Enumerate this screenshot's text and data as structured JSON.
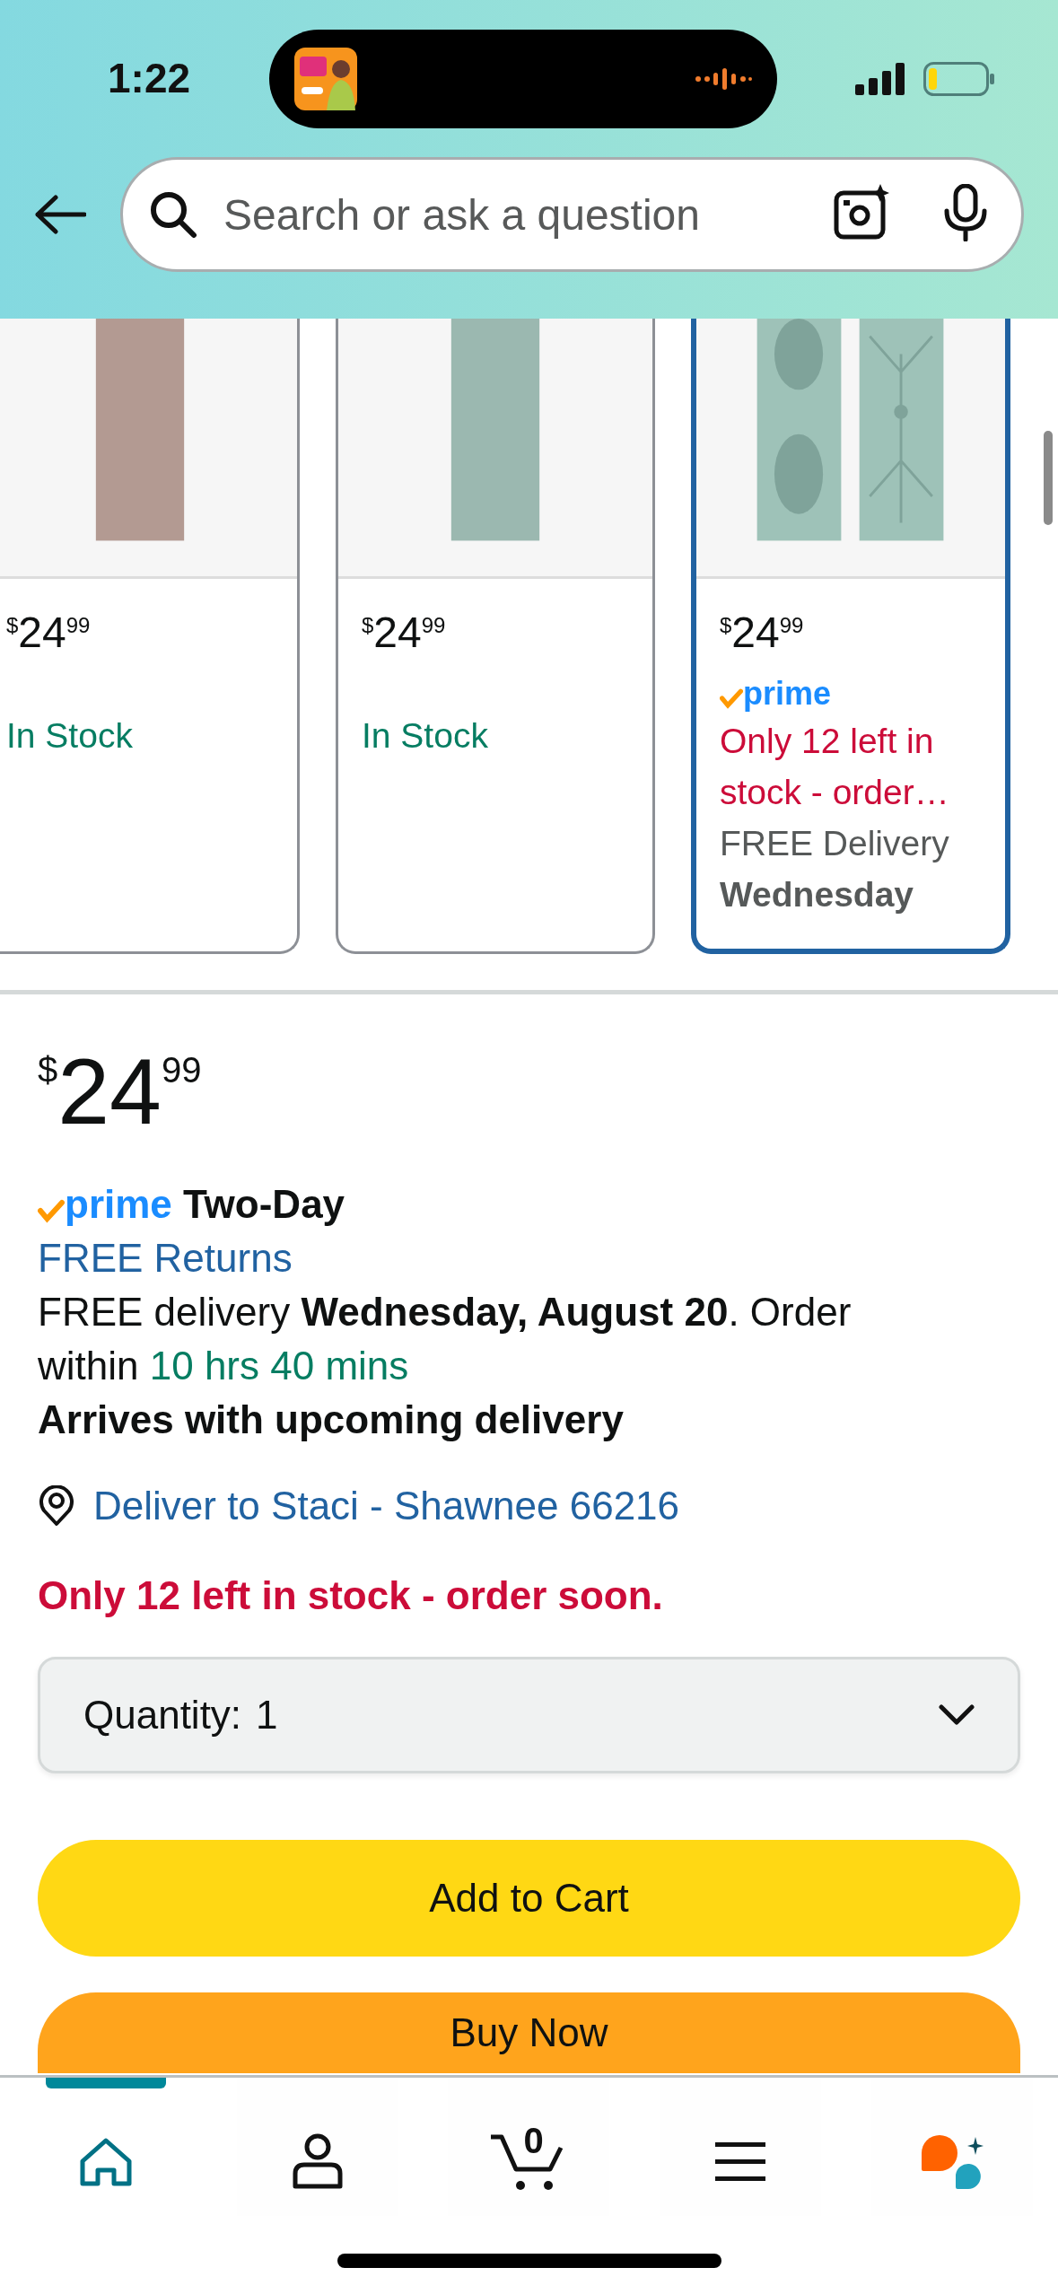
{
  "status_bar": {
    "time": "1:22"
  },
  "search": {
    "placeholder": "Search or ask a question"
  },
  "cards": [
    {
      "currency": "$",
      "whole": "24",
      "fraction": "99",
      "selected": false,
      "lines": [
        {
          "kind": "stock",
          "text": "In Stock"
        }
      ]
    },
    {
      "currency": "$",
      "whole": "24",
      "fraction": "99",
      "selected": false,
      "lines": [
        {
          "kind": "stock",
          "text": "In Stock"
        }
      ]
    },
    {
      "currency": "$",
      "whole": "24",
      "fraction": "99",
      "selected": true,
      "badge": "prime",
      "lines": [
        {
          "kind": "urgent",
          "text": "Only 12 left in stock - order…"
        },
        {
          "kind": "note",
          "text": "FREE Delivery"
        },
        {
          "kind": "strong",
          "text": "Wednesday"
        }
      ]
    }
  ],
  "product": {
    "currency": "$",
    "whole": "24",
    "fraction": "99",
    "prime_logo": "prime",
    "prime_label": "Two-Day",
    "returns": "FREE Returns",
    "delivery": "FREE delivery **Wednesday, August 20**. Order within",
    "countdown": "10 hrs 40 mins",
    "arrival": "Arrives with upcoming delivery",
    "location": "Deliver to Staci - Shawnee 66216",
    "stock": "Only 12 left in stock - order soon.",
    "quantity_label": "Quantity:",
    "quantity_value": "1"
  },
  "buttons": [
    {
      "kind": "cart",
      "label": "Add to Cart"
    },
    {
      "kind": "buy",
      "label": "Buy Now"
    }
  ],
  "nav": [
    {
      "kind": "home",
      "selected": true
    },
    {
      "kind": "account",
      "selected": false
    },
    {
      "kind": "cart",
      "selected": false,
      "count": "0"
    },
    {
      "kind": "menu",
      "selected": false
    },
    {
      "kind": "assistant",
      "selected": false
    }
  ]
}
